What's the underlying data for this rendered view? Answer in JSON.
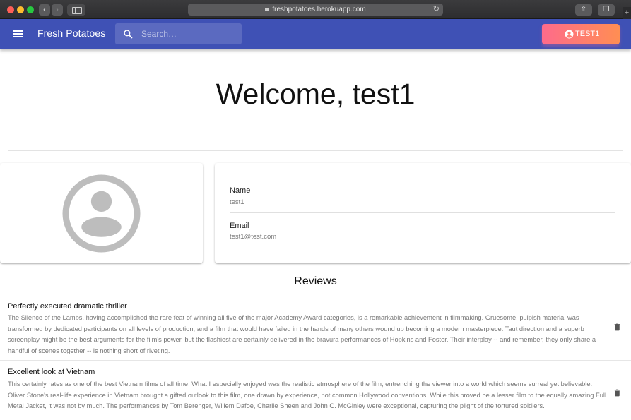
{
  "browser": {
    "url": "freshpotatoes.herokuapp.com",
    "plus": "+"
  },
  "appbar": {
    "brand": "Fresh Potatoes",
    "search_placeholder": "Search…",
    "user_button": "TEST1",
    "color": "#3f51b5"
  },
  "welcome": {
    "heading": "Welcome, test1"
  },
  "profile": {
    "name_label": "Name",
    "name_value": "test1",
    "email_label": "Email",
    "email_value": "test1@test.com"
  },
  "reviews": {
    "title": "Reviews",
    "items": [
      {
        "title": "Perfectly executed dramatic thriller",
        "text": "The Silence of the Lambs, having accomplished the rare feat of winning all five of the major Academy Award categories, is a remarkable achievement in filmmaking. Gruesome, pulpish material was transformed by dedicated participants on all levels of production, and a film that would have failed in the hands of many others wound up becoming a modern masterpiece. Taut direction and a superb screenplay might be the best arguments for the film's power, but the flashiest are certainly delivered in the bravura performances of Hopkins and Foster. Their interplay -- and remember, they only share a handful of scenes together -- is nothing short of riveting."
      },
      {
        "title": "Excellent look at Vietnam",
        "text": "This certainly rates as one of the best Vietnam films of all time. What I especially enjoyed was the realistic atmosphere of the film, entrenching the viewer into a world which seems surreal yet believable. Oliver Stone's real-life experience in Vietnam brought a gifted outlook to this film, one drawn by experience, not common Hollywood conventions. While this proved be a lesser film to the equally amazing Full Metal Jacket, it was not by much. The performances by Tom Berenger, Willem Dafoe, Charlie Sheen and John C. McGinley were exceptional, capturing the plight of the tortured soldiers."
      }
    ]
  }
}
